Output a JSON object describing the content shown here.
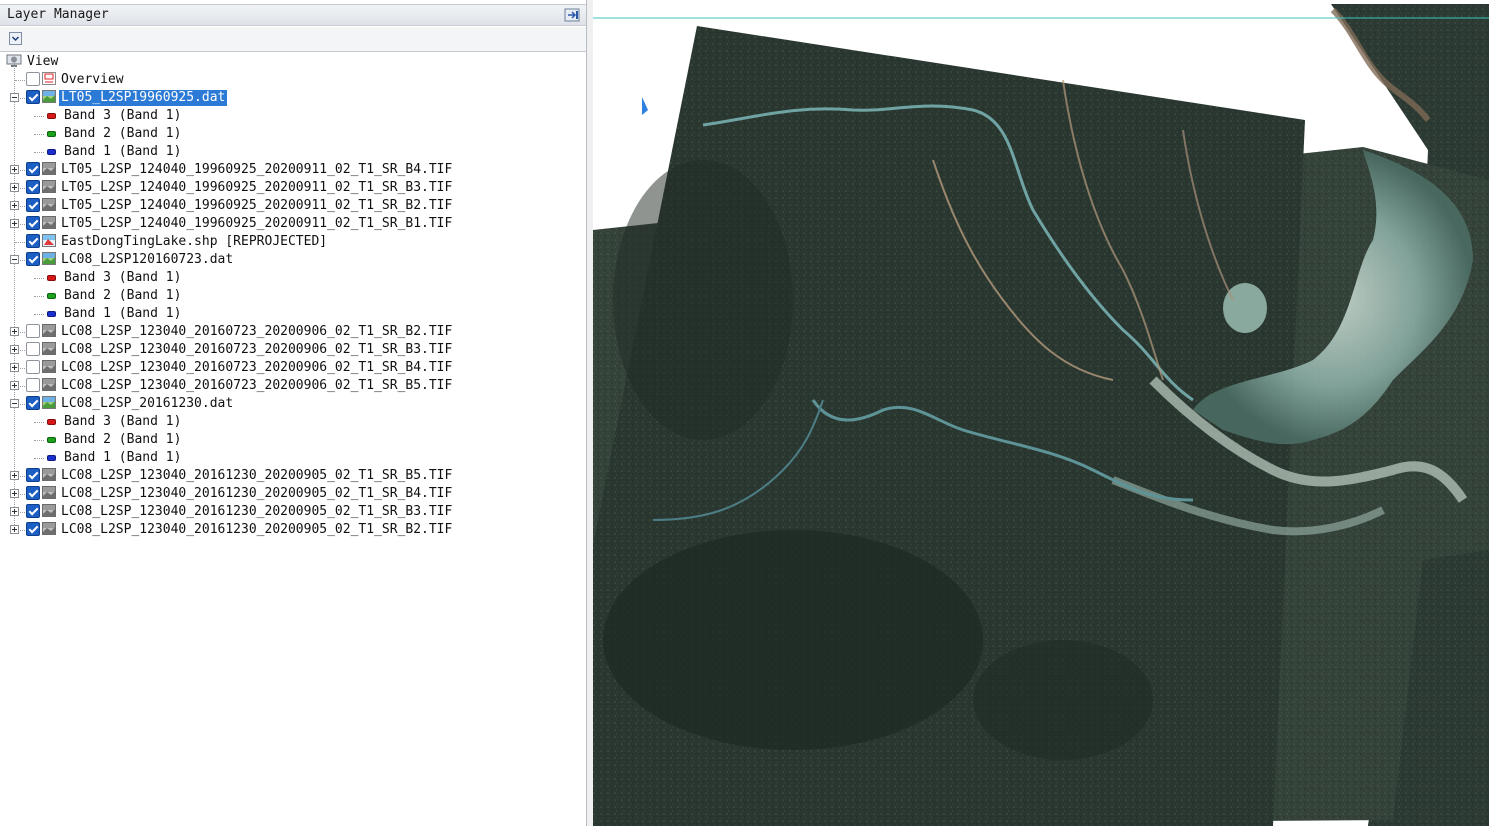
{
  "window": {
    "title": "Layer Manager"
  },
  "tree": {
    "root": "View",
    "rows": [
      {
        "label": "Overview",
        "kind": "overview",
        "level": 1,
        "checked": false
      },
      {
        "label": "LT05_L2SP19960925.dat",
        "kind": "raster",
        "level": 1,
        "checked": true,
        "expanded": true,
        "selected": true
      },
      {
        "label": "Band 3 (Band 1)",
        "kind": "band",
        "band_color": "#d81818",
        "level": 2
      },
      {
        "label": "Band 2 (Band 1)",
        "kind": "band",
        "band_color": "#1aa31a",
        "level": 2
      },
      {
        "label": "Band 1 (Band 1)",
        "kind": "band",
        "band_color": "#1a2fd0",
        "level": 2
      },
      {
        "label": "LT05_L2SP_124040_19960925_20200911_02_T1_SR_B4.TIF",
        "kind": "gray",
        "level": 1,
        "checked": true,
        "expanded": false
      },
      {
        "label": "LT05_L2SP_124040_19960925_20200911_02_T1_SR_B3.TIF",
        "kind": "gray",
        "level": 1,
        "checked": true,
        "expanded": false
      },
      {
        "label": "LT05_L2SP_124040_19960925_20200911_02_T1_SR_B2.TIF",
        "kind": "gray",
        "level": 1,
        "checked": true,
        "expanded": false
      },
      {
        "label": "LT05_L2SP_124040_19960925_20200911_02_T1_SR_B1.TIF",
        "kind": "gray",
        "level": 1,
        "checked": true,
        "expanded": false
      },
      {
        "label": "EastDongTingLake.shp [REPROJECTED]",
        "kind": "vector",
        "level": 1,
        "checked": true
      },
      {
        "label": "LC08_L2SP120160723.dat",
        "kind": "raster",
        "level": 1,
        "checked": true,
        "expanded": true
      },
      {
        "label": "Band 3 (Band 1)",
        "kind": "band",
        "band_color": "#d81818",
        "level": 2
      },
      {
        "label": "Band 2 (Band 1)",
        "kind": "band",
        "band_color": "#1aa31a",
        "level": 2
      },
      {
        "label": "Band 1 (Band 1)",
        "kind": "band",
        "band_color": "#1a2fd0",
        "level": 2
      },
      {
        "label": "LC08_L2SP_123040_20160723_20200906_02_T1_SR_B2.TIF",
        "kind": "gray",
        "level": 1,
        "checked": false,
        "expanded": false
      },
      {
        "label": "LC08_L2SP_123040_20160723_20200906_02_T1_SR_B3.TIF",
        "kind": "gray",
        "level": 1,
        "checked": false,
        "expanded": false
      },
      {
        "label": "LC08_L2SP_123040_20160723_20200906_02_T1_SR_B4.TIF",
        "kind": "gray",
        "level": 1,
        "checked": false,
        "expanded": false
      },
      {
        "label": "LC08_L2SP_123040_20160723_20200906_02_T1_SR_B5.TIF",
        "kind": "gray",
        "level": 1,
        "checked": false,
        "expanded": false
      },
      {
        "label": "LC08_L2SP_20161230.dat",
        "kind": "raster",
        "level": 1,
        "checked": true,
        "expanded": true
      },
      {
        "label": "Band 3 (Band 1)",
        "kind": "band",
        "band_color": "#d81818",
        "level": 2
      },
      {
        "label": "Band 2 (Band 1)",
        "kind": "band",
        "band_color": "#1aa31a",
        "level": 2
      },
      {
        "label": "Band 1 (Band 1)",
        "kind": "band",
        "band_color": "#1a2fd0",
        "level": 2
      },
      {
        "label": "LC08_L2SP_123040_20161230_20200905_02_T1_SR_B5.TIF",
        "kind": "gray",
        "level": 1,
        "checked": true,
        "expanded": false
      },
      {
        "label": "LC08_L2SP_123040_20161230_20200905_02_T1_SR_B4.TIF",
        "kind": "gray",
        "level": 1,
        "checked": true,
        "expanded": false
      },
      {
        "label": "LC08_L2SP_123040_20161230_20200905_02_T1_SR_B3.TIF",
        "kind": "gray",
        "level": 1,
        "checked": true,
        "expanded": false
      },
      {
        "label": "LC08_L2SP_123040_20161230_20200905_02_T1_SR_B2.TIF",
        "kind": "gray",
        "level": 1,
        "checked": true,
        "expanded": false
      }
    ]
  },
  "colors": {
    "selection": "#2b7ad6",
    "checkbox_on": "#1b5fc4",
    "map_guide_line": "#3cc7c0"
  }
}
